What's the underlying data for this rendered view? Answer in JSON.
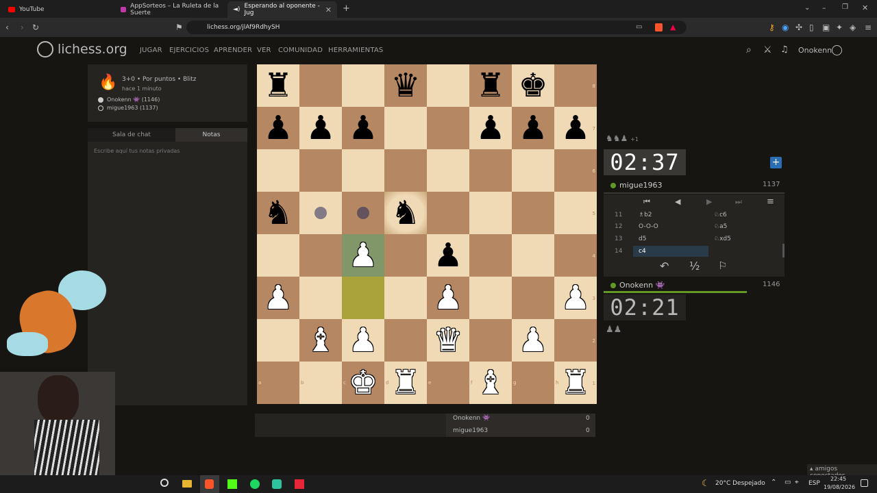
{
  "browser": {
    "tabs": [
      {
        "label": "YouTube"
      },
      {
        "label": "AppSorteos – La Ruleta de la Suerte"
      },
      {
        "label": "Esperando al oponente - Jug"
      }
    ],
    "url": "lichess.org/jlAf9RdhySH"
  },
  "header": {
    "logo": "lichess.org",
    "nav": [
      "JUGAR",
      "EJERCICIOS",
      "APRENDER",
      "VER",
      "COMUNIDAD",
      "HERRAMIENTAS"
    ],
    "username": "Onokenn"
  },
  "game": {
    "mode": "3+0 • Por puntos • Blitz",
    "time_ago": "hace 1 minuto",
    "white_player": "Onokenn 👾 (1146)",
    "black_player": "migue1963 (1137)"
  },
  "panel": {
    "tabs": [
      "Sala de chat",
      "Notas"
    ],
    "notes_placeholder": "Escribe aquí tus notas privadas"
  },
  "board": {
    "ranks": [
      [
        "bR",
        "",
        "",
        "bQ",
        "",
        "bR",
        "bK",
        ""
      ],
      [
        "bP",
        "bP",
        "bP",
        "",
        "",
        "bP",
        "bP",
        "bP"
      ],
      [
        "",
        "",
        "",
        "",
        "",
        "",
        "",
        ""
      ],
      [
        "bN",
        "dot",
        "dot",
        "bN",
        "",
        "",
        "",
        ""
      ],
      [
        "",
        "",
        "wP",
        "",
        "bP",
        "",
        "",
        ""
      ],
      [
        "wP",
        "",
        "",
        "",
        "wP",
        "",
        "",
        "wP"
      ],
      [
        "",
        "wB",
        "wP",
        "",
        "wQ",
        "",
        "wP",
        ""
      ],
      [
        "",
        "",
        "wK",
        "wR",
        "",
        "wB",
        "",
        "wR"
      ]
    ],
    "files": [
      "a",
      "b",
      "c",
      "d",
      "e",
      "f",
      "g",
      "h"
    ],
    "rank_labels": [
      "8",
      "7",
      "6",
      "5",
      "4",
      "3",
      "2",
      "1"
    ]
  },
  "top_player": {
    "captured": "+1",
    "clock": "02:37",
    "name": "migue1963",
    "rating": "1137"
  },
  "bottom_player": {
    "clock": "02:21",
    "name": "Onokenn 👾",
    "rating": "1146"
  },
  "moves": [
    {
      "num": "11",
      "white": "♗b2",
      "black": "♘c6"
    },
    {
      "num": "12",
      "white": "O-O-O",
      "black": "♘a5"
    },
    {
      "num": "13",
      "white": "d5",
      "black": "♘xd5"
    },
    {
      "num": "14",
      "white": "c4",
      "black": ""
    }
  ],
  "actions": {
    "draw": "½"
  },
  "score": [
    {
      "name": "Onokenn 👾",
      "score": "0"
    },
    {
      "name": "migue1963",
      "score": "0"
    }
  ],
  "taskbar": {
    "weather": "20°C  Despejado",
    "lang": "ESP",
    "time": "22:45",
    "date": "19/08/2026",
    "friends": "amigos conectados"
  }
}
